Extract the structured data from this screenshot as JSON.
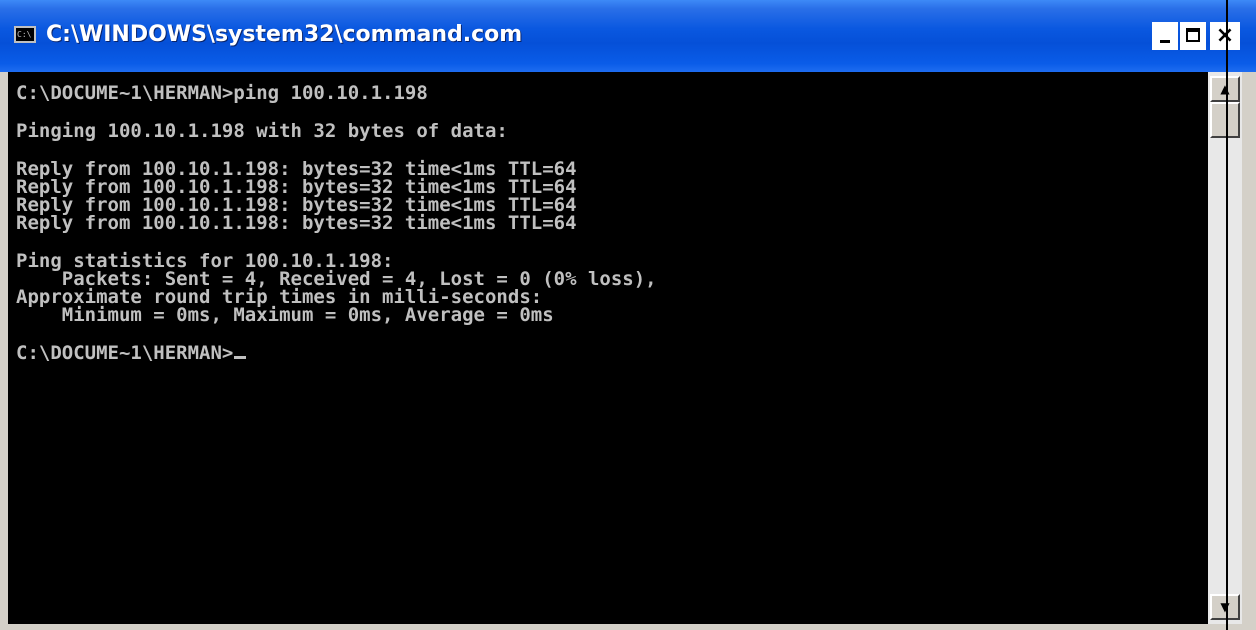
{
  "window": {
    "title": "C:\\WINDOWS\\system32\\command.com",
    "icon_name": "console-app-icon",
    "icon_text": "C:\\",
    "buttons": {
      "minimize_icon": "minimize-icon",
      "maximize_icon": "maximize-icon",
      "close_icon": "close-icon",
      "close_glyph": "×"
    },
    "colors": {
      "titlebar": "#0550d8",
      "console_bg": "#000000",
      "console_text": "#c0c0c0"
    }
  },
  "console": {
    "lines": [
      "C:\\DOCUME~1\\HERMAN>ping 100.10.1.198",
      "",
      "Pinging 100.10.1.198 with 32 bytes of data:",
      "",
      "Reply from 100.10.1.198: bytes=32 time<1ms TTL=64",
      "Reply from 100.10.1.198: bytes=32 time<1ms TTL=64",
      "Reply from 100.10.1.198: bytes=32 time<1ms TTL=64",
      "Reply from 100.10.1.198: bytes=32 time<1ms TTL=64",
      "",
      "Ping statistics for 100.10.1.198:",
      "    Packets: Sent = 4, Received = 4, Lost = 0 (0% loss),",
      "Approximate round trip times in milli-seconds:",
      "    Minimum = 0ms, Maximum = 0ms, Average = 0ms",
      "",
      "C:\\DOCUME~1\\HERMAN>"
    ]
  },
  "scrollbar": {
    "up_glyph": "▲",
    "down_glyph": "▼"
  }
}
